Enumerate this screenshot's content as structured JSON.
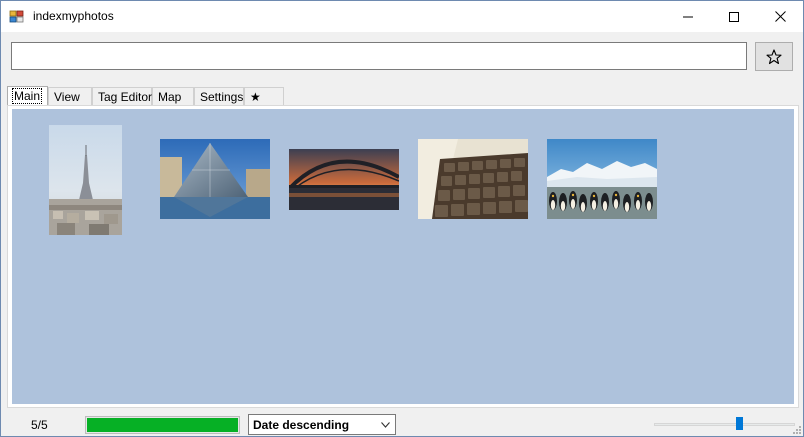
{
  "window": {
    "title": "indexmyphotos",
    "controls": [
      "minimize-icon",
      "maximize-icon",
      "close-icon"
    ]
  },
  "search": {
    "value": "",
    "placeholder": ""
  },
  "toolbar": {
    "favorite_icon": "star-outline-icon"
  },
  "tabs": [
    {
      "label": "Main",
      "active": true
    },
    {
      "label": "View",
      "active": false
    },
    {
      "label": "Tag Editor",
      "active": false
    },
    {
      "label": "Map",
      "active": false
    },
    {
      "label": "Settings",
      "active": false
    },
    {
      "label": "★",
      "active": false
    }
  ],
  "photos": [
    {
      "subject": "Eiffel Tower, Paris"
    },
    {
      "subject": "Louvre Pyramid"
    },
    {
      "subject": "Sydney Harbour Bridge at sunset"
    },
    {
      "subject": "Vintage keyboard"
    },
    {
      "subject": "Penguins on ice"
    }
  ],
  "status": {
    "count": "5/5",
    "progress": 1.0,
    "progress_color": "#06b025",
    "sort_selected": "Date descending",
    "zoom_level": 0.6
  },
  "colors": {
    "panel_background": "#aec2dc",
    "accent": "#0078d7"
  }
}
